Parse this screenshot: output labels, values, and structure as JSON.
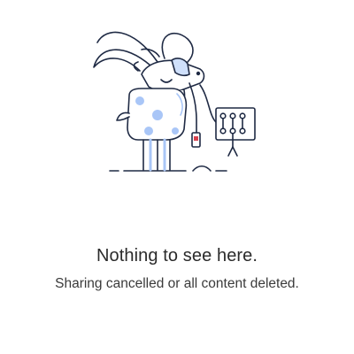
{
  "empty_state": {
    "title": "Nothing to see here.",
    "subtitle": "Sharing cancelled or all content deleted.",
    "illustration": "goat-unplugged-icon"
  },
  "colors": {
    "background": "#ffffff",
    "outline": "#1f2a44",
    "accent_fill": "#cfe0fb",
    "accent_spot": "#a9c6f7",
    "plug_red": "#d9434f",
    "title_text": "#2b2b2b",
    "subtitle_text": "#3a3a3a"
  }
}
